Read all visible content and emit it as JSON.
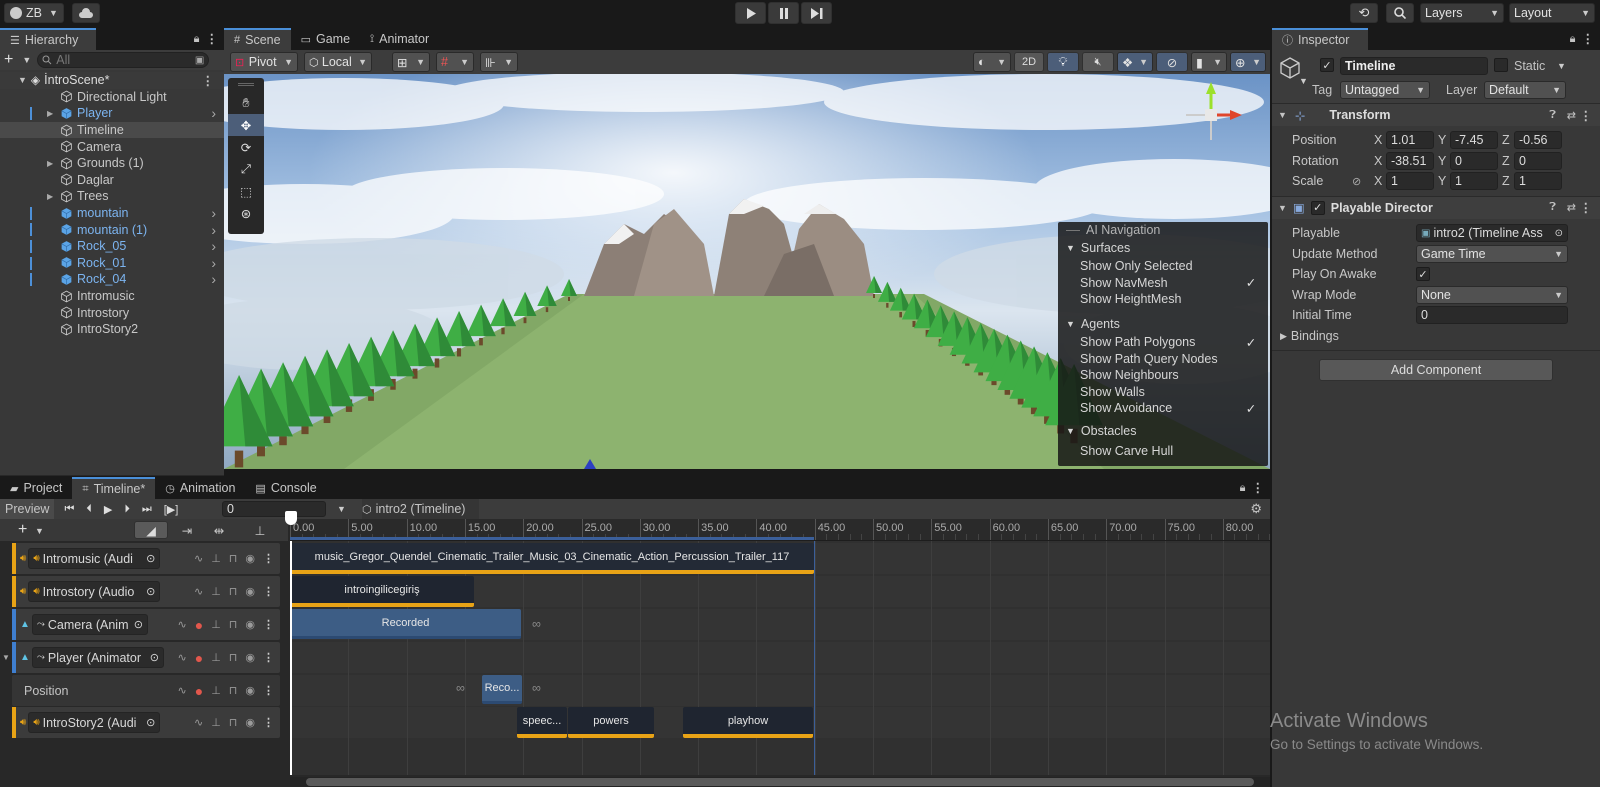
{
  "toolbar": {
    "account": "ZB",
    "layers": "Layers",
    "layout": "Layout"
  },
  "hierarchy": {
    "tab": "Hierarchy",
    "search_placeholder": "All",
    "scene": "İntroScene*",
    "items": [
      {
        "label": "Directional Light",
        "blue": false,
        "arrow": false
      },
      {
        "label": "Player",
        "blue": true,
        "arrow": true
      },
      {
        "label": "Timeline",
        "blue": false,
        "arrow": false
      },
      {
        "label": "Camera",
        "blue": false,
        "arrow": false
      },
      {
        "label": "Grounds (1)",
        "blue": false,
        "arrow": true
      },
      {
        "label": "Daglar",
        "blue": false,
        "arrow": false
      },
      {
        "label": "Trees",
        "blue": false,
        "arrow": true
      },
      {
        "label": "mountain",
        "blue": true,
        "arrow": false
      },
      {
        "label": "mountain (1)",
        "blue": true,
        "arrow": false
      },
      {
        "label": "Rock_05",
        "blue": true,
        "arrow": false
      },
      {
        "label": "Rock_01",
        "blue": true,
        "arrow": false
      },
      {
        "label": "Rock_04",
        "blue": true,
        "arrow": false
      },
      {
        "label": "Intromusic",
        "blue": false,
        "arrow": false
      },
      {
        "label": "Introstory",
        "blue": false,
        "arrow": false
      },
      {
        "label": "IntroStory2",
        "blue": false,
        "arrow": false
      }
    ]
  },
  "scene": {
    "tabs": [
      "Scene",
      "Game",
      "Animator"
    ],
    "pivot": "Pivot",
    "local": "Local",
    "mode2d": "2D"
  },
  "ai_nav": {
    "title": "AI Navigation",
    "surfaces": "Surfaces",
    "surface_items": [
      {
        "label": "Show Only Selected",
        "checked": false
      },
      {
        "label": "Show NavMesh",
        "checked": true
      },
      {
        "label": "Show HeightMesh",
        "checked": false
      }
    ],
    "agents": "Agents",
    "agent_items": [
      {
        "label": "Show Path Polygons",
        "checked": true
      },
      {
        "label": "Show Path Query Nodes",
        "checked": false
      },
      {
        "label": "Show Neighbours",
        "checked": false
      },
      {
        "label": "Show Walls",
        "checked": false
      },
      {
        "label": "Show Avoidance",
        "checked": true
      }
    ],
    "obstacles": "Obstacles",
    "obstacle_items": [
      {
        "label": "Show Carve Hull",
        "checked": false
      }
    ]
  },
  "inspector": {
    "tab": "Inspector",
    "object_name": "Timeline",
    "static": "Static",
    "tag_label": "Tag",
    "tag": "Untagged",
    "layer_label": "Layer",
    "layer": "Default",
    "transform": "Transform",
    "position": "Position",
    "rotation": "Rotation",
    "scale": "Scale",
    "pos": {
      "x": "1.01",
      "y": "-7.45",
      "z": "-0.56"
    },
    "rot": {
      "x": "-38.51",
      "y": "0",
      "z": "0"
    },
    "scl": {
      "x": "1",
      "y": "1",
      "z": "1"
    },
    "axis": {
      "x": "X",
      "y": "Y",
      "z": "Z"
    },
    "director": "Playable Director",
    "playable_label": "Playable",
    "playable": "intro2 (Timeline Ass",
    "update_label": "Update Method",
    "update": "Game Time",
    "awake_label": "Play On Awake",
    "wrap_label": "Wrap Mode",
    "wrap": "None",
    "initial_label": "Initial Time",
    "initial": "0",
    "bindings": "Bindings",
    "add_component": "Add Component"
  },
  "bottom": {
    "tabs": [
      "Project",
      "Timeline*",
      "Animation",
      "Console"
    ],
    "preview": "Preview",
    "frame": "0",
    "breadcrumb": "intro2 (Timeline)",
    "ticks": [
      "0.00",
      "5.00",
      "10.00",
      "15.00",
      "20.00",
      "25.00",
      "30.00",
      "35.00",
      "40.00",
      "45.00",
      "50.00",
      "55.00",
      "60.00",
      "65.00",
      "70.00",
      "75.00",
      "80.00"
    ],
    "tracks": [
      {
        "label": "Intromusic (Audi",
        "kind": "audio"
      },
      {
        "label": "Introstory (Audio",
        "kind": "audio"
      },
      {
        "label": "Camera (Anim",
        "kind": "anim"
      },
      {
        "label": "Player (Animator",
        "kind": "anim"
      },
      {
        "label": "Position",
        "kind": "sub"
      },
      {
        "label": "IntroStory2 (Audi",
        "kind": "audio"
      }
    ],
    "clips": {
      "music": "music_Gregor_Quendel_Cinematic_Trailer_Music_03_Cinematic_Action_Percussion_Trailer_117",
      "intro": "introingilicegiriş",
      "recorded": "Recorded",
      "reco": "Reco...",
      "speech": "speec...",
      "powers": "powers",
      "playhow": "playhow"
    }
  },
  "watermark": {
    "line1": "Activate Windows",
    "line2": "Go to Settings to activate Windows."
  }
}
